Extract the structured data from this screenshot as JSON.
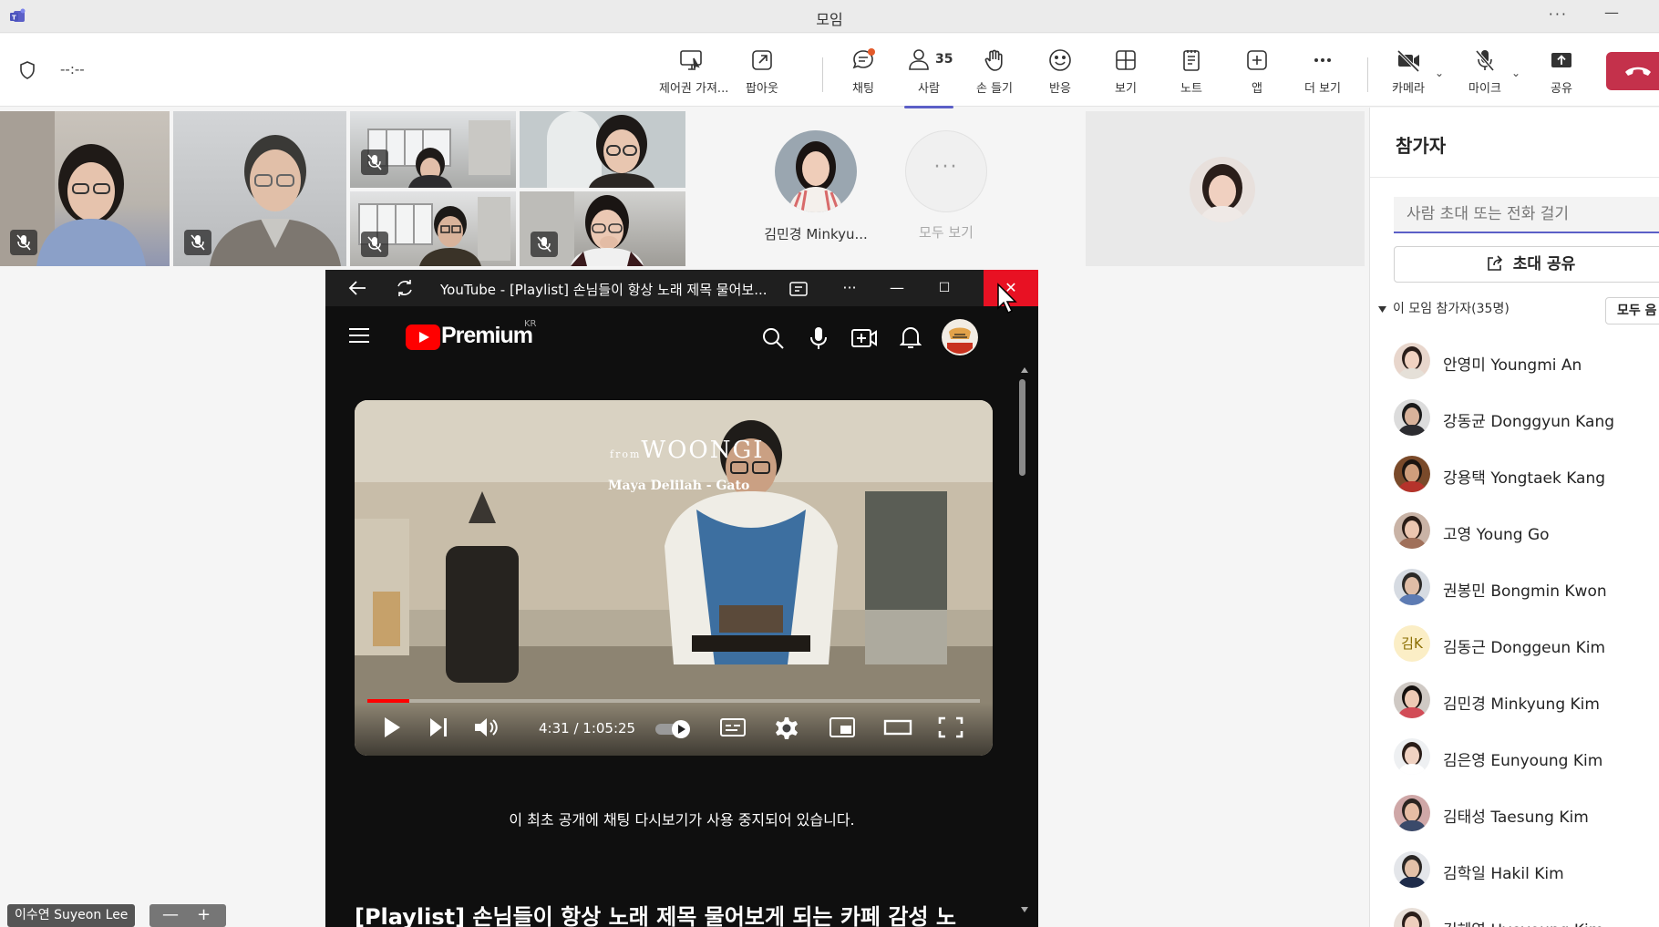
{
  "window": {
    "title": "모임"
  },
  "toolbar": {
    "timer": "--:--",
    "items": [
      {
        "label": "제어권 가져..."
      },
      {
        "label": "팝아웃"
      },
      {
        "label": "채팅"
      },
      {
        "label": "사람",
        "count": "35"
      },
      {
        "label": "손 들기"
      },
      {
        "label": "반응"
      },
      {
        "label": "보기"
      },
      {
        "label": "노트"
      },
      {
        "label": "앱"
      },
      {
        "label": "더 보기"
      },
      {
        "label": "카메라"
      },
      {
        "label": "마이크"
      },
      {
        "label": "공유"
      }
    ]
  },
  "stage": {
    "featured_name": "김민경 Minkyu...",
    "see_all": "모두 보기"
  },
  "self_view": {
    "name": "이수연 Suyeon Lee"
  },
  "zoom": {
    "minus": "—",
    "plus": "+"
  },
  "youtube_window": {
    "title": "YouTube - [Playlist] 손님들이 항상 노래 제목 물어보...",
    "logo_text": "Premium",
    "region": "KR",
    "video": {
      "brand_overlay": "WOONGI",
      "brand_prefix": "from",
      "song_overlay": "Maya Delilah - Gato",
      "time": "4:31 / 1:05:25",
      "progress": 0.069
    },
    "notice": "이 최초 공개에 채팅 다시보기가 사용 중지되어 있습니다.",
    "video_title": "[Playlist] 손님들이 항상 노래 제목 물어보게 되는 카페 감성 노"
  },
  "panel": {
    "title": "참가자",
    "invite_placeholder": "사람 초대 또는 전화 걸기",
    "share_invite": "초대 공유",
    "section": "이 모임 참가자(35명)",
    "mute_all": "모두 음",
    "participants": [
      {
        "name": "안영미 Youngmi An"
      },
      {
        "name": "강동균 Donggyun Kang"
      },
      {
        "name": "강용택 Yongtaek Kang"
      },
      {
        "name": "고영 Young Go"
      },
      {
        "name": "권봉민 Bongmin Kwon"
      },
      {
        "name": "김동근 Donggeun Kim",
        "initials": "김K"
      },
      {
        "name": "김민경 Minkyung Kim"
      },
      {
        "name": "김은영 Eunyoung Kim"
      },
      {
        "name": "김태성 Taesung Kim"
      },
      {
        "name": "김학일 Hakil Kim"
      },
      {
        "name": "김혜영 Hyeyoung Kim"
      }
    ]
  }
}
